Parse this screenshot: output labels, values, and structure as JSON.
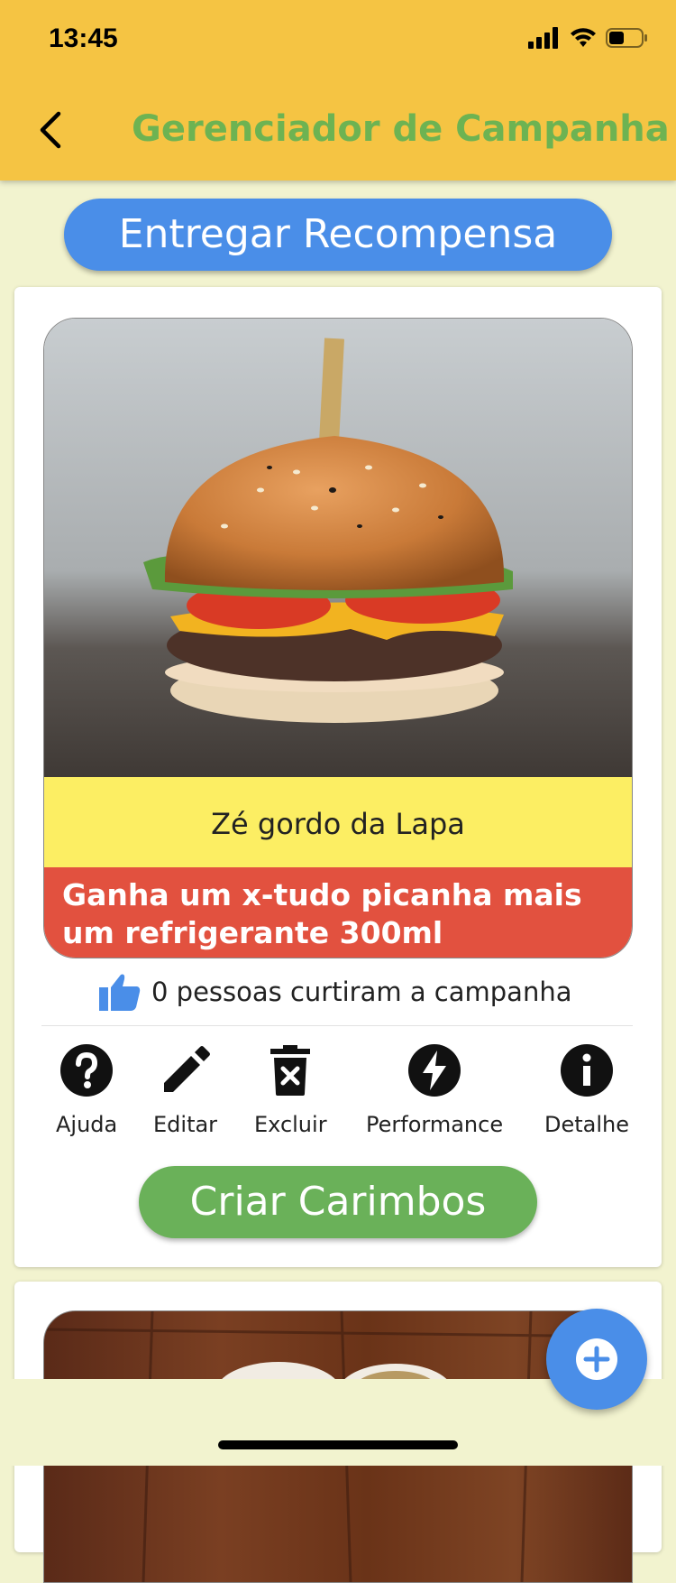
{
  "status_bar": {
    "time": "13:45"
  },
  "appbar": {
    "title": "Gerenciador de Campanha",
    "back_icon": "chevron-left-icon"
  },
  "deliver_button": {
    "label": "Entregar Recompensa"
  },
  "campaign": {
    "name": "Zé gordo da Lapa",
    "reward": "Ganha um x-tudo picanha mais um refrigerante 300ml",
    "likes_text": "0 pessoas curtiram a campanha",
    "image_icon": "burger-photo"
  },
  "actions": [
    {
      "label": "Ajuda",
      "icon": "help-icon"
    },
    {
      "label": "Editar",
      "icon": "pencil-icon"
    },
    {
      "label": "Excluir",
      "icon": "trash-icon"
    },
    {
      "label": "Performance",
      "icon": "bolt-icon"
    },
    {
      "label": "Detalhe",
      "icon": "info-icon"
    }
  ],
  "create_stamps_button": {
    "label": "Criar Carimbos"
  },
  "fab": {
    "icon": "plus-icon"
  },
  "colors": {
    "appbar": "#f5c443",
    "title": "#6db352",
    "blue": "#4a8ee8",
    "green": "#6ab159",
    "name_bg": "#fcee63",
    "reward_bg": "#e2513f",
    "page_bg": "#f2f3cf"
  }
}
